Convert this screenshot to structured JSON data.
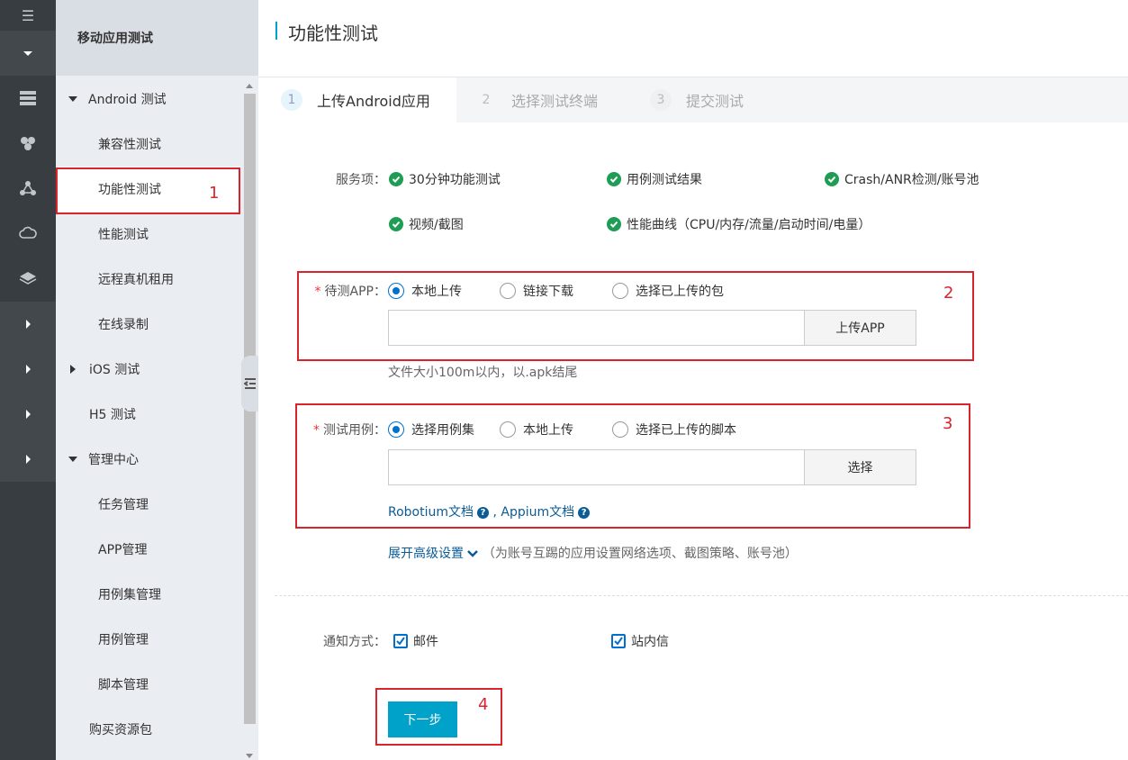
{
  "rail": {
    "menu_icon": "hamburger-icon",
    "icons": [
      "server-icon",
      "cubes-icon",
      "nodes-icon",
      "cloud-icon",
      "layers-icon"
    ]
  },
  "sidebar": {
    "title": "移动应用测试",
    "groups": {
      "android": "Android 测试",
      "ios": "iOS 测试",
      "h5": "H5 测试",
      "manage": "管理中心",
      "buy": "购买资源包"
    },
    "android_items": [
      "兼容性测试",
      "功能性测试",
      "性能测试",
      "远程真机租用",
      "在线录制"
    ],
    "manage_items": [
      "任务管理",
      "APP管理",
      "用例集管理",
      "用例管理",
      "脚本管理"
    ]
  },
  "page": {
    "title": "功能性测试"
  },
  "steps": [
    {
      "num": "1",
      "label": "上传Android应用"
    },
    {
      "num": "2",
      "label": "选择测试终端"
    },
    {
      "num": "3",
      "label": "提交测试"
    }
  ],
  "services": {
    "label": "服务项：",
    "items": [
      "30分钟功能测试",
      "用例测试结果",
      "Crash/ANR检测/账号池",
      "视频/截图",
      "性能曲线（CPU/内存/流量/启动时间/电量）"
    ]
  },
  "app": {
    "required": "*",
    "label": "待测APP：",
    "options": [
      "本地上传",
      "链接下载",
      "选择已上传的包"
    ],
    "selected": 0,
    "input_value": "",
    "button": "上传APP",
    "hint": "文件大小100m以内，以.apk结尾"
  },
  "case": {
    "required": "*",
    "label": "测试用例：",
    "options": [
      "选择用例集",
      "本地上传",
      "选择已上传的脚本"
    ],
    "selected": 0,
    "input_value": "",
    "button": "选择",
    "link1": "Robotium文档",
    "sep": ",",
    "link2": "Appium文档"
  },
  "advanced": {
    "link": "展开高级设置",
    "desc": "（为账号互踢的应用设置网络选项、截图策略、账号池）"
  },
  "notify": {
    "label": "通知方式：",
    "options": [
      {
        "label": "邮件",
        "checked": true
      },
      {
        "label": "站内信",
        "checked": true
      }
    ]
  },
  "next_button": "下一步",
  "annotations": [
    "1",
    "2",
    "3",
    "4"
  ],
  "colors": {
    "accent": "#00a2ca",
    "annotation": "#d9232d",
    "check": "#1f9d55"
  }
}
